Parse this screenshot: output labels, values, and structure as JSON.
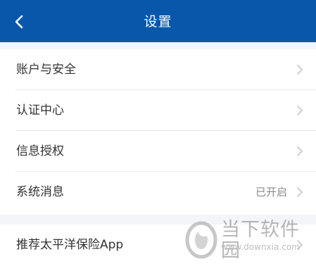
{
  "header": {
    "title": "设置",
    "background_color": "#0857ab",
    "back_icon": "chevron-left-icon"
  },
  "settings": {
    "group1": [
      {
        "label": "账户与安全",
        "value": ""
      },
      {
        "label": "认证中心",
        "value": ""
      },
      {
        "label": "信息授权",
        "value": ""
      },
      {
        "label": "系统消息",
        "value": "已开启"
      }
    ],
    "group2": [
      {
        "label": "推荐太平洋保险App",
        "value": ""
      }
    ],
    "chevron_icon": "chevron-right-icon"
  },
  "watermark": {
    "text": "当下软件园",
    "url": "www.downxia.com"
  }
}
